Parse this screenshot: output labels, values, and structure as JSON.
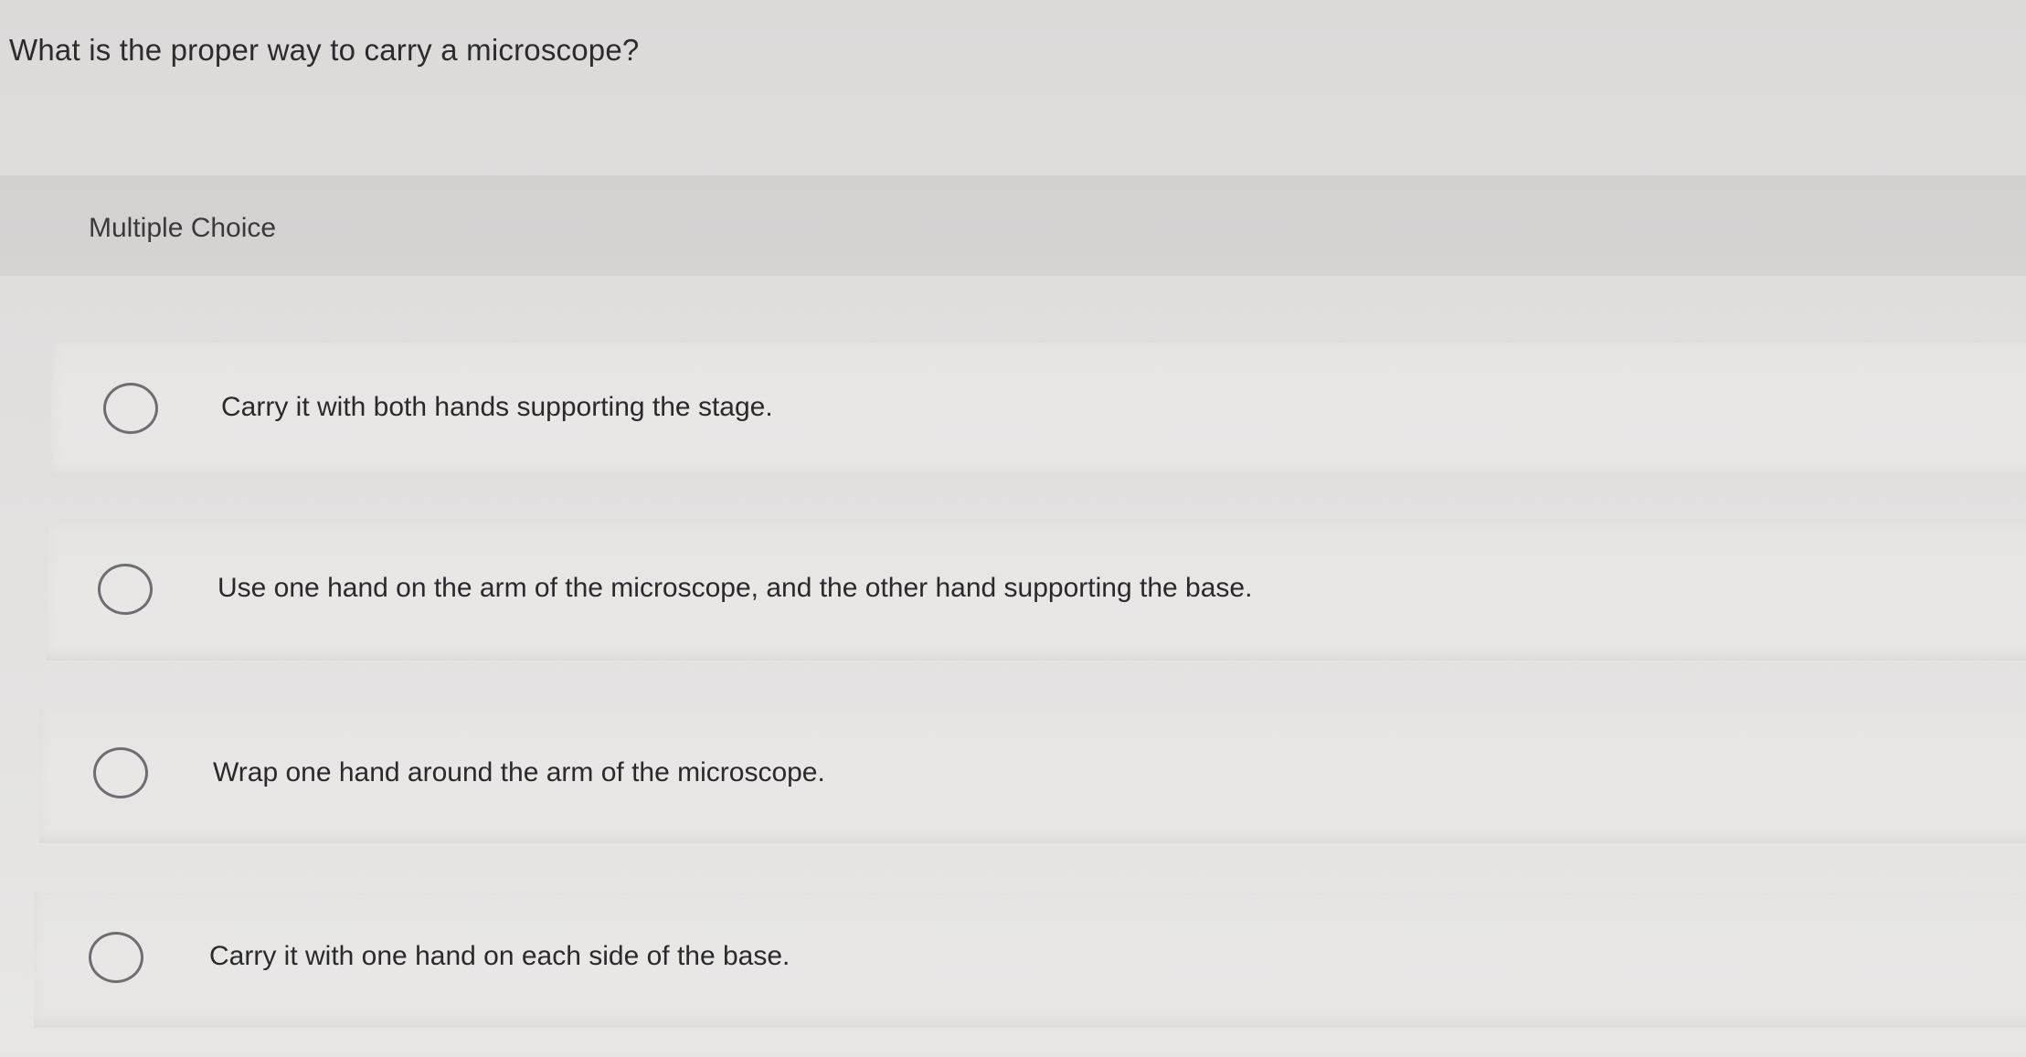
{
  "question": {
    "text": "What is the proper way to carry a microscope?"
  },
  "question_type": {
    "label": "Multiple Choice"
  },
  "choices": [
    {
      "label": "Carry it with both hands supporting the stage.",
      "selected": false
    },
    {
      "label": "Use one hand on the arm of the microscope, and the other hand supporting the base.",
      "selected": false
    },
    {
      "label": "Wrap one hand around the arm of the microscope.",
      "selected": false
    },
    {
      "label": "Carry it with one hand on each side of the base.",
      "selected": false
    }
  ],
  "colors": {
    "radio_border": "#6d6e72",
    "text": "#2a2a2c",
    "band": "#d4d2d1"
  }
}
